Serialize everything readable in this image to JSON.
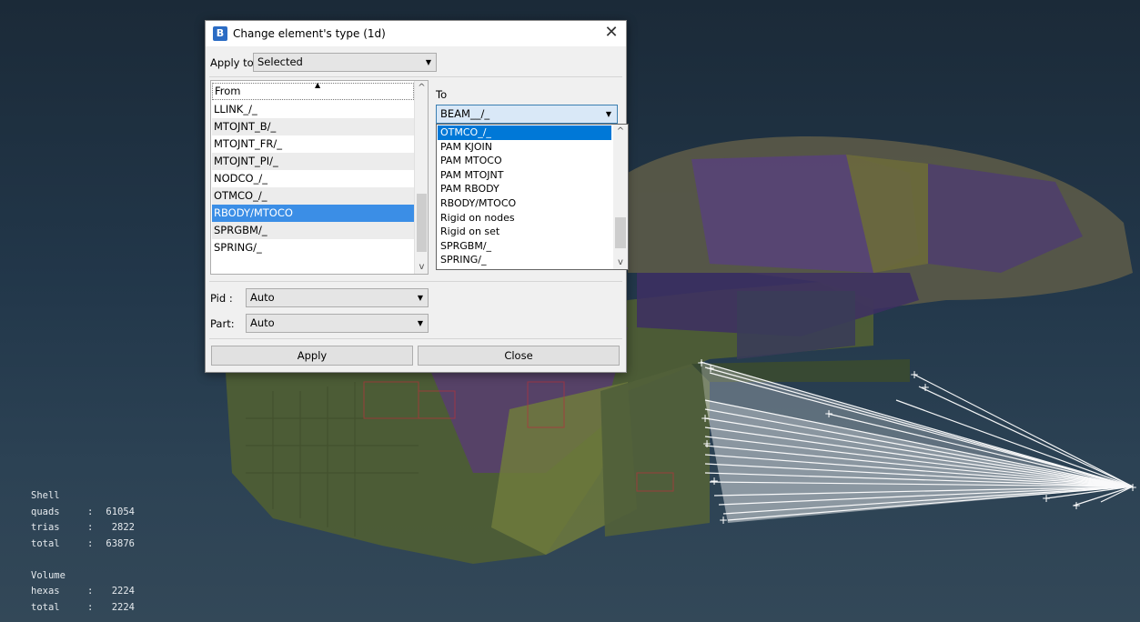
{
  "viewport": {
    "stats": {
      "shell_heading": "Shell",
      "shell_rows": [
        {
          "label": "quads",
          "value": "61054"
        },
        {
          "label": "trias",
          "value": "2822"
        },
        {
          "label": "total",
          "value": "63876"
        }
      ],
      "volume_heading": "Volume",
      "volume_rows": [
        {
          "label": "hexas",
          "value": "2224"
        },
        {
          "label": "total",
          "value": "2224"
        }
      ]
    }
  },
  "dialog": {
    "title": "Change element's type (1d)",
    "app_icon_glyph": "B",
    "close_glyph": "✕",
    "apply_to": {
      "label": "Apply to",
      "value": "Selected"
    },
    "from": {
      "header": "From",
      "items": [
        "LLINK_/_",
        "MTOJNT_B/_",
        "MTOJNT_FR/_",
        "MTOJNT_PI/_",
        "NODCO_/_",
        "OTMCO_/_",
        "RBODY/MTOCO",
        "SPRGBM/_",
        "SPRING/_"
      ],
      "selected_index": 6
    },
    "to": {
      "label": "To",
      "value": "BEAM__/_",
      "options": [
        "OTMCO_/_",
        "PAM KJOIN",
        "PAM MTOCO",
        "PAM MTOJNT",
        "PAM RBODY",
        "RBODY/MTOCO",
        "Rigid on nodes",
        "Rigid on set",
        "SPRGBM/_",
        "SPRING/_"
      ],
      "selected_index": 0
    },
    "pid": {
      "label": "Pid :",
      "value": "Auto"
    },
    "part": {
      "label": "Part:",
      "value": "Auto"
    },
    "buttons": {
      "apply": "Apply",
      "close": "Close"
    }
  },
  "icons": {
    "app": "app-logo-icon",
    "close": "close-icon",
    "dropdown": "chevron-down-icon",
    "scroll_up": "scroll-up-arrow-icon",
    "scroll_down": "scroll-down-arrow-icon",
    "sort": "sort-ascending-icon"
  },
  "colors": {
    "selection_blue": "#3b8ee6",
    "dropdown_selection": "#0078d7",
    "model_green": "#5c6a3a",
    "model_purple": "#5a3a78",
    "beam_lines": "#ffffff"
  }
}
